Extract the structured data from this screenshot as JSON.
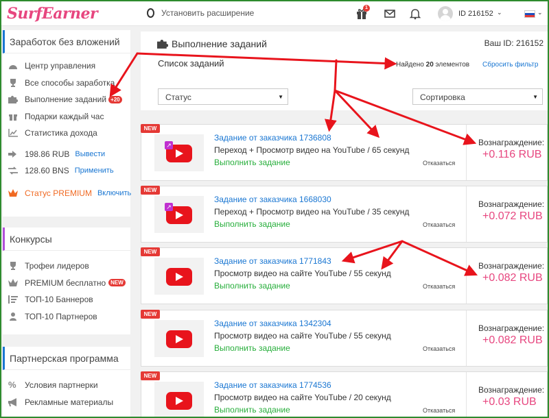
{
  "header": {
    "logo": "SurfEarner",
    "extension": "Установить расширение",
    "gift_badge": "1",
    "user_id": "ID 216152",
    "icons": [
      "opera-icon",
      "gift-icon",
      "mail-icon",
      "bell-icon",
      "avatar",
      "chevron-down-icon",
      "flag-ru-icon"
    ],
    "flag_colors": [
      "#ffffff",
      "#1c4fbf",
      "#e53935"
    ]
  },
  "sidebar": {
    "earn": {
      "title": "Заработок без вложений",
      "accent": "#1976d2",
      "items": [
        {
          "label": "Центр управления",
          "icon": "gauge-icon"
        },
        {
          "label": "Все способы заработка",
          "icon": "trophy-icon"
        },
        {
          "label": "Выполнение заданий",
          "icon": "puzzle-icon",
          "badge": "+20"
        },
        {
          "label": "Подарки каждый час",
          "icon": "gift-icon"
        },
        {
          "label": "Статистика дохода",
          "icon": "chart-icon"
        }
      ],
      "balance_rub": "198.86 RUB",
      "withdraw": "Вывести",
      "balance_bns": "128.60 BNS",
      "apply": "Применить",
      "premium": "Статус PREMIUM",
      "enable": "Включить",
      "premium_color": "#f06a23"
    },
    "contests": {
      "title": "Конкурсы",
      "accent": "#b14fd9",
      "items": [
        {
          "label": "Трофеи лидеров",
          "icon": "trophy-icon"
        },
        {
          "label": "PREMIUM бесплатно",
          "icon": "crown-icon",
          "badge": "NEW"
        },
        {
          "label": "ТОП-10 Баннеров",
          "icon": "list-icon"
        },
        {
          "label": "ТОП-10 Партнеров",
          "icon": "user-icon"
        }
      ]
    },
    "partner": {
      "title": "Партнерская программа",
      "accent": "#1976d2",
      "items": [
        {
          "label": "Условия партнерки",
          "icon": "percent-icon"
        },
        {
          "label": "Рекламные материалы",
          "icon": "megaphone-icon"
        }
      ]
    }
  },
  "main": {
    "title": "Выполнение заданий",
    "your_id": "Ваш ID: 216152",
    "list_title": "Список заданий",
    "found_prefix": "Найдено ",
    "found_count": "20",
    "found_suffix": " элементов",
    "reset": "Сбросить фильтр",
    "status_select": "Статус",
    "sort_select": "Сортировка"
  },
  "tasks": [
    {
      "badge": "NEW",
      "title": "Задание от заказчика 1736808",
      "desc": "Переход + Просмотр видео на YouTube / 65 секунд",
      "action": "Выполнить задание",
      "skip": "Отказаться",
      "reward_label": "Вознаграждение:",
      "reward": "+0.116 RUB",
      "share": true
    },
    {
      "badge": "NEW",
      "title": "Задание от заказчика 1668030",
      "desc": "Переход + Просмотр видео на YouTube / 35 секунд",
      "action": "Выполнить задание",
      "skip": "Отказаться",
      "reward_label": "Вознаграждение:",
      "reward": "+0.072 RUB",
      "share": true
    },
    {
      "badge": "NEW",
      "title": "Задание от заказчика 1771843",
      "desc": "Просмотр видео на сайте YouTube / 55 секунд",
      "action": "Выполнить задание",
      "skip": "Отказаться",
      "reward_label": "Вознаграждение:",
      "reward": "+0.082 RUB",
      "share": false
    },
    {
      "badge": "NEW",
      "title": "Задание от заказчика 1342304",
      "desc": "Просмотр видео на сайте YouTube / 55 секунд",
      "action": "Выполнить задание",
      "skip": "Отказаться",
      "reward_label": "Вознаграждение:",
      "reward": "+0.082 RUB",
      "share": false
    },
    {
      "badge": "NEW",
      "title": "Задание от заказчика 1774536",
      "desc": "Просмотр видео на сайте YouTube / 20 секунд",
      "action": "Выполнить задание",
      "skip": "Отказаться",
      "reward_label": "Вознаграждение:",
      "reward": "+0.03 RUB",
      "share": false
    }
  ],
  "annotation_color": "#e8141c"
}
